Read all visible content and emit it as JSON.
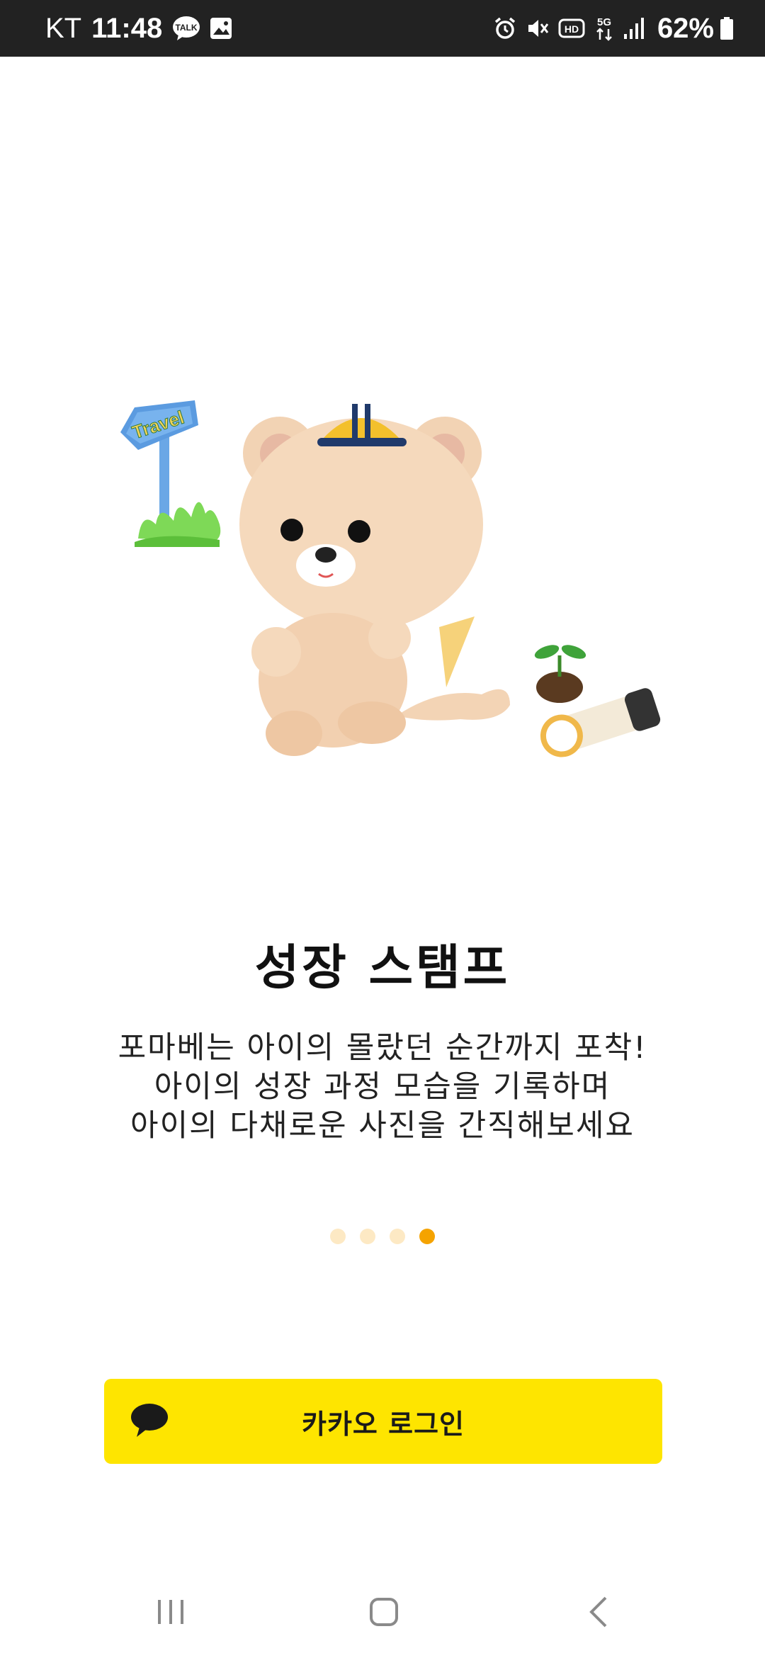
{
  "status_bar": {
    "carrier": "KT",
    "time": "11:48",
    "battery_percent": "62%",
    "left_icons": [
      "kakaotalk-icon",
      "gallery-icon"
    ],
    "right_icons": [
      "alarm-icon",
      "mute-icon",
      "hd-icon",
      "5g-icon",
      "signal-icon",
      "battery-icon"
    ]
  },
  "onboarding": {
    "title": "성장 스탬프",
    "description_lines": [
      "포마베는 아이의 몰랐던 순간까지 포착!",
      "아이의 성장 과정 모습을 기록하며",
      "아이의 다채로운 사진을 간직해보세요"
    ],
    "illustration": {
      "sign_text": "Travel"
    },
    "pager": {
      "total": 4,
      "active_index": 3
    }
  },
  "login": {
    "kakao_label": "카카오 로그인",
    "icon": "speech-bubble-icon"
  },
  "nav_bar": {
    "buttons": [
      "recent-apps-icon",
      "home-icon",
      "back-icon"
    ]
  },
  "colors": {
    "status_bar_bg": "#222222",
    "kakao_yellow": "#FEE500",
    "pager_active": "#F5A300",
    "pager_inactive": "#FDE9C4"
  }
}
